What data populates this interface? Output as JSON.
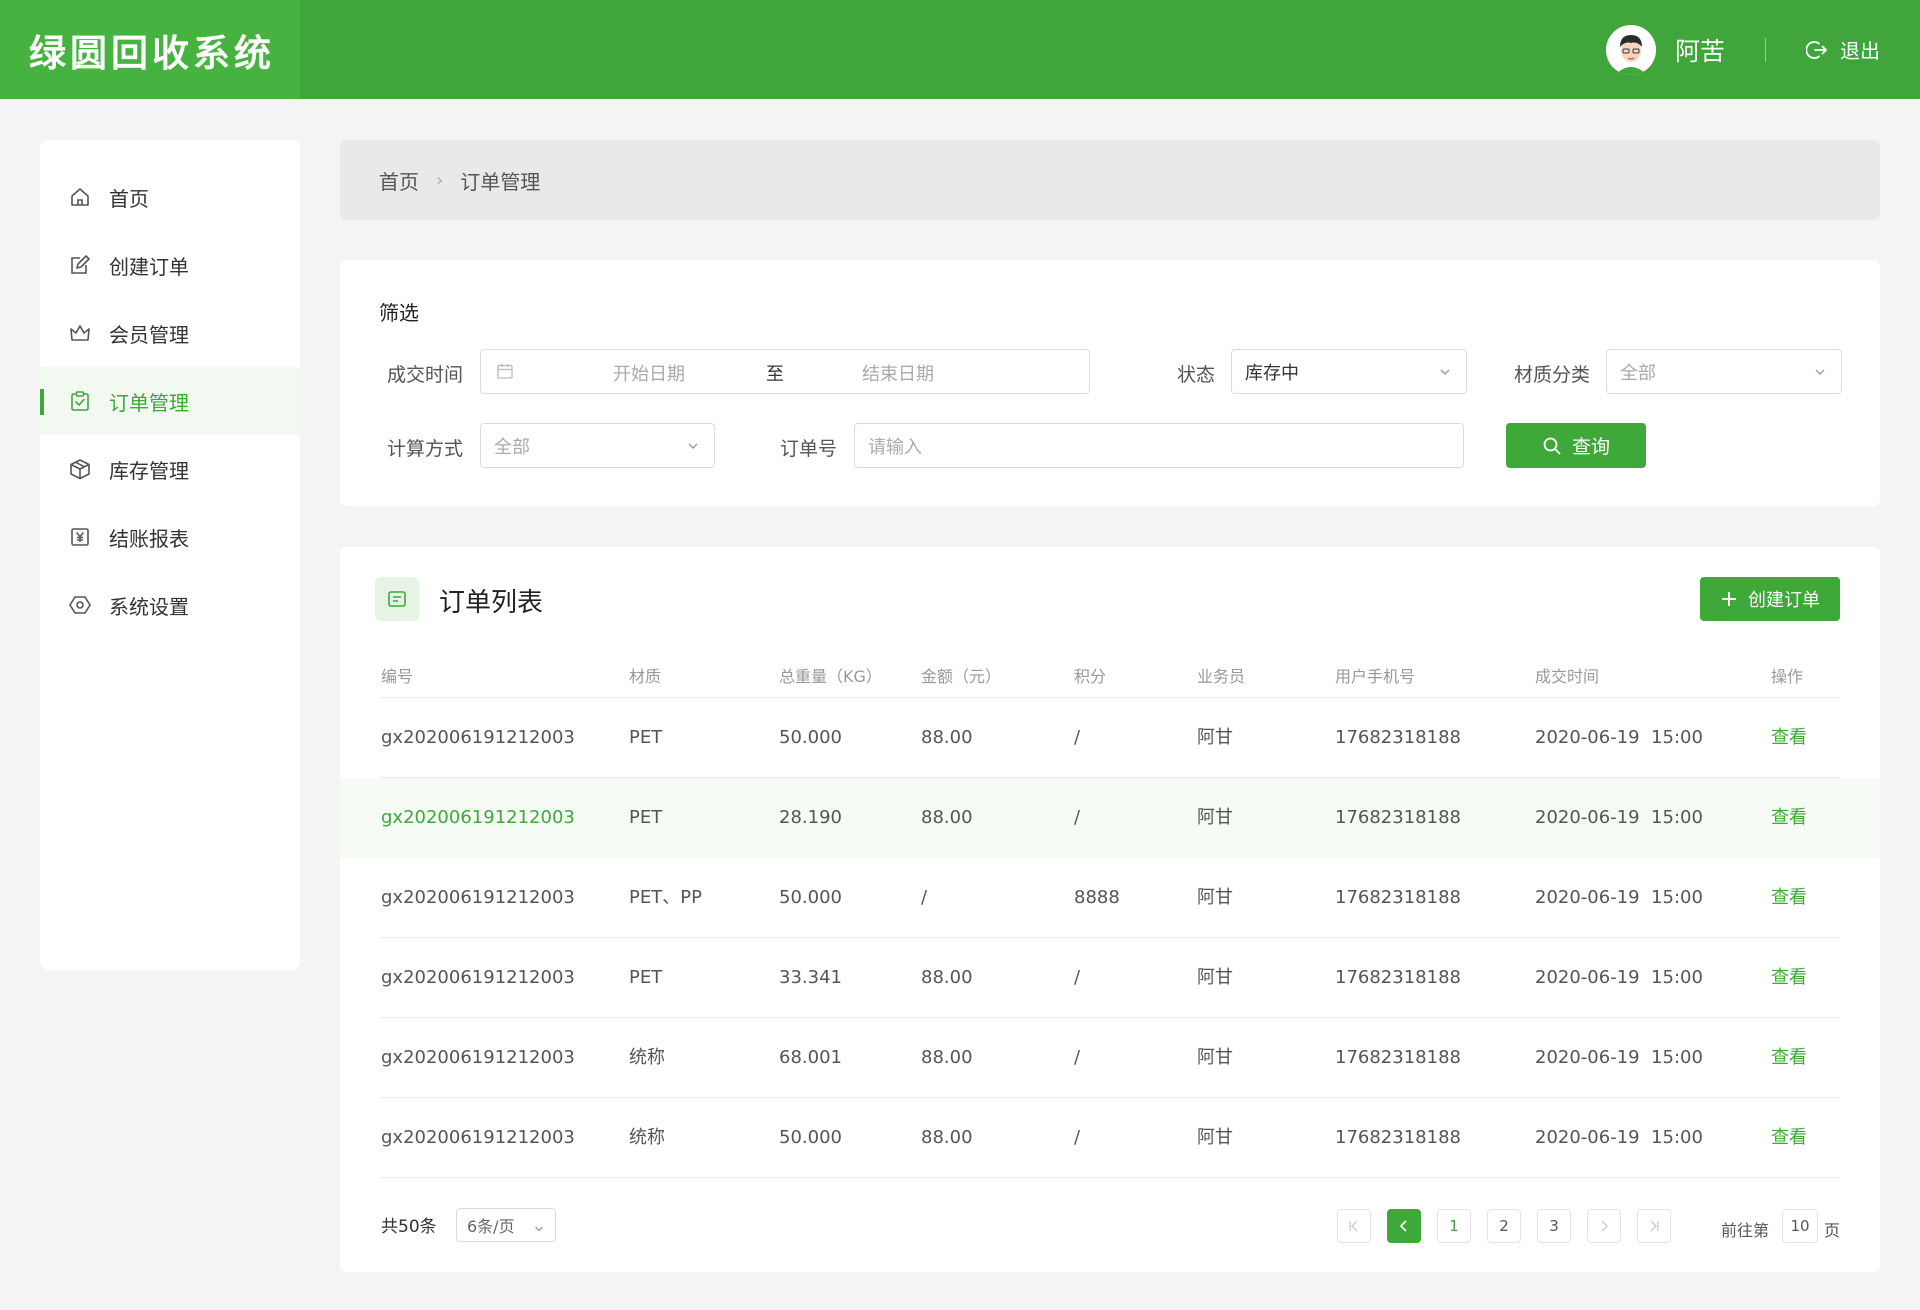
{
  "app": {
    "title": "绿圆回收系统"
  },
  "header": {
    "username": "阿苦",
    "logout_label": "退出",
    "avatar_icon": "user-avatar"
  },
  "sidebar": {
    "items": [
      {
        "label": "首页",
        "icon": "home-icon",
        "active": false
      },
      {
        "label": "创建订单",
        "icon": "edit-icon",
        "active": false
      },
      {
        "label": "会员管理",
        "icon": "crown-icon",
        "active": false
      },
      {
        "label": "订单管理",
        "icon": "clipboard-check-icon",
        "active": true
      },
      {
        "label": "库存管理",
        "icon": "box-icon",
        "active": false
      },
      {
        "label": "结账报表",
        "icon": "yuan-icon",
        "active": false
      },
      {
        "label": "系统设置",
        "icon": "settings-icon",
        "active": false
      }
    ]
  },
  "breadcrumb": {
    "home": "首页",
    "current": "订单管理"
  },
  "filter": {
    "title": "筛选",
    "deal_time_label": "成交时间",
    "start_placeholder": "开始日期",
    "to_label": "至",
    "end_placeholder": "结束日期",
    "status_label": "状态",
    "status_value": "库存中",
    "material_label": "材质分类",
    "material_value": "全部",
    "calc_label": "计算方式",
    "calc_value": "全部",
    "order_no_label": "订单号",
    "order_no_placeholder": "请输入",
    "query_label": "查询"
  },
  "list": {
    "title": "订单列表",
    "create_label": "创建订单",
    "columns": [
      "编号",
      "材质",
      "总重量（KG）",
      "金额（元）",
      "积分",
      "业务员",
      "用户手机号",
      "成交时间",
      "操作"
    ],
    "rows": [
      {
        "code": "gx202006191212003",
        "material": "PET",
        "weight": "50.000",
        "amount": "88.00",
        "points": "/",
        "staff": "阿甘",
        "phone": "17682318188",
        "time": "2020-06-19  15:00",
        "action": "查看"
      },
      {
        "code": "gx202006191212003",
        "material": "PET",
        "weight": "28.190",
        "amount": "88.00",
        "points": "/",
        "staff": "阿甘",
        "phone": "17682318188",
        "time": "2020-06-19  15:00",
        "action": "查看"
      },
      {
        "code": "gx202006191212003",
        "material": "PET、PP",
        "weight": "50.000",
        "amount": "/",
        "points": "8888",
        "staff": "阿甘",
        "phone": "17682318188",
        "time": "2020-06-19  15:00",
        "action": "查看"
      },
      {
        "code": "gx202006191212003",
        "material": "PET",
        "weight": "33.341",
        "amount": "88.00",
        "points": "/",
        "staff": "阿甘",
        "phone": "17682318188",
        "time": "2020-06-19  15:00",
        "action": "查看"
      },
      {
        "code": "gx202006191212003",
        "material": "统称",
        "weight": "68.001",
        "amount": "88.00",
        "points": "/",
        "staff": "阿甘",
        "phone": "17682318188",
        "time": "2020-06-19  15:00",
        "action": "查看"
      },
      {
        "code": "gx202006191212003",
        "material": "统称",
        "weight": "50.000",
        "amount": "88.00",
        "points": "/",
        "staff": "阿甘",
        "phone": "17682318188",
        "time": "2020-06-19  15:00",
        "action": "查看"
      }
    ]
  },
  "pagination": {
    "total_label": "共50条",
    "page_size": "6条/页",
    "pages": [
      "1",
      "2",
      "3"
    ],
    "goto_prefix": "前往第",
    "goto_value": "10",
    "goto_suffix": "页"
  },
  "colors": {
    "primary": "#3ea838",
    "header": "#40a53b",
    "brand_block": "#46b341"
  }
}
